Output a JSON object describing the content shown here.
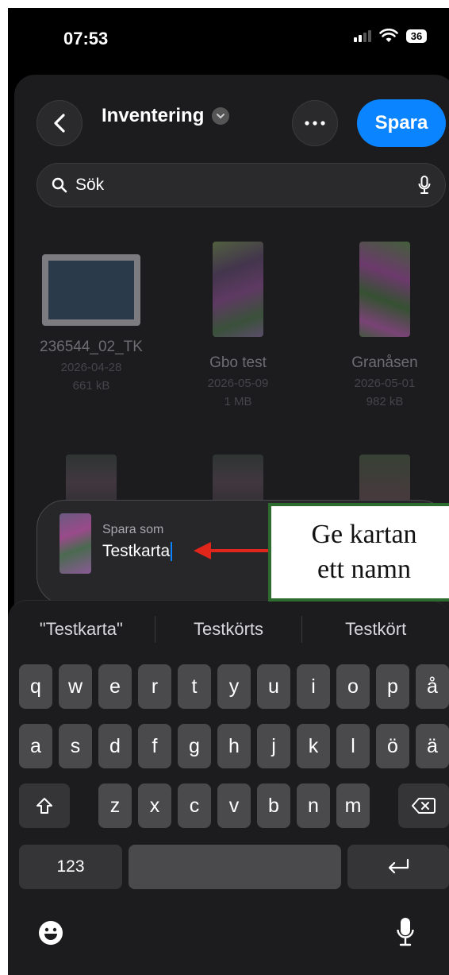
{
  "status": {
    "time": "07:53",
    "battery": "36"
  },
  "header": {
    "title": "Inventering",
    "save_label": "Spara"
  },
  "search": {
    "placeholder": "Sök"
  },
  "files": [
    {
      "name": "236544_02_TK",
      "date": "2026-04-28",
      "size": "661 kB"
    },
    {
      "name": "Gbo test",
      "date": "2026-05-09",
      "size": "1 MB"
    },
    {
      "name": "Granåsen",
      "date": "2026-05-01",
      "size": "982 kB"
    }
  ],
  "save_as": {
    "label": "Spara som",
    "value": "Testkarta"
  },
  "annotation": {
    "line1": "Ge kartan",
    "line2": "ett namn"
  },
  "keyboard": {
    "suggestions": [
      "\"Testkarta\"",
      "Testkörts",
      "Testkört"
    ],
    "row1": [
      "q",
      "w",
      "e",
      "r",
      "t",
      "y",
      "u",
      "i",
      "o",
      "p",
      "å"
    ],
    "row2": [
      "a",
      "s",
      "d",
      "f",
      "g",
      "h",
      "j",
      "k",
      "l",
      "ö",
      "ä"
    ],
    "row3": [
      "z",
      "x",
      "c",
      "v",
      "b",
      "n",
      "m"
    ],
    "numbers_label": "123"
  },
  "colors": {
    "accent": "#0a84ff",
    "annotation_border": "#2e6b2e",
    "arrow": "#e0251b"
  }
}
